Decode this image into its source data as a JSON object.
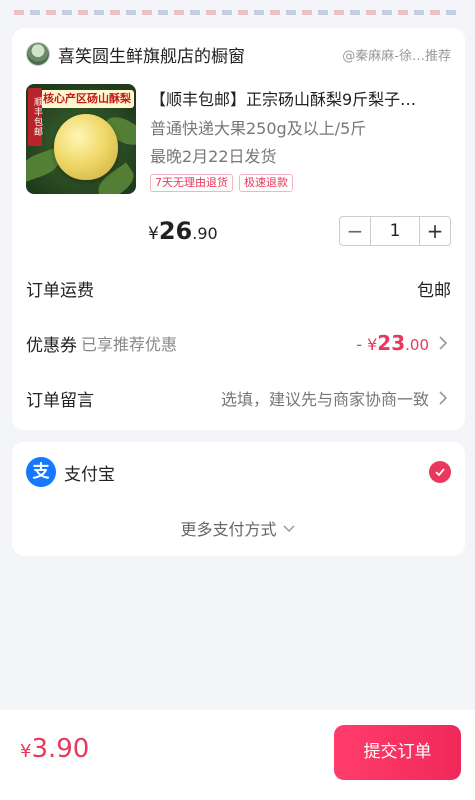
{
  "shop": {
    "name": "喜笑圆生鲜旗舰店的橱窗",
    "recommender": "@秦麻麻-徐…推荐"
  },
  "product": {
    "title": "【顺丰包邮】正宗砀山酥梨9斤梨子…",
    "spec": "普通快递大果250g及以上/5斤",
    "ship_date": "最晚2月22日发货",
    "image_banner": "核心产区砀山酥梨",
    "image_side_label": "顺丰包邮",
    "tags": [
      "7天无理由退货",
      "极速退款"
    ],
    "price_currency": "¥",
    "price_int": "26",
    "price_dec": ".90",
    "quantity": "1"
  },
  "order": {
    "freight_label": "订单运费",
    "freight_value": "包邮",
    "coupon_label": "优惠券",
    "coupon_sub": "已享推荐优惠",
    "coupon_minus": "- ¥",
    "coupon_int": "23",
    "coupon_dec": ".00",
    "note_label": "订单留言",
    "note_placeholder": "选填，建议先与商家协商一致"
  },
  "payment": {
    "alipay_logo": "支",
    "alipay_label": "支付宝",
    "more_label": "更多支付方式"
  },
  "footer": {
    "total_currency": "¥",
    "total_amount": "3.90",
    "submit_label": "提交订单"
  },
  "colors": {
    "accent": "#e8385c",
    "alipay": "#1677ff",
    "background": "#f4f5f9"
  },
  "icons": {
    "shop": "shop-avatar-icon",
    "check": "check-circle-icon",
    "chevron_right": "chevron-right-icon",
    "chevron_down": "chevron-down-icon"
  }
}
